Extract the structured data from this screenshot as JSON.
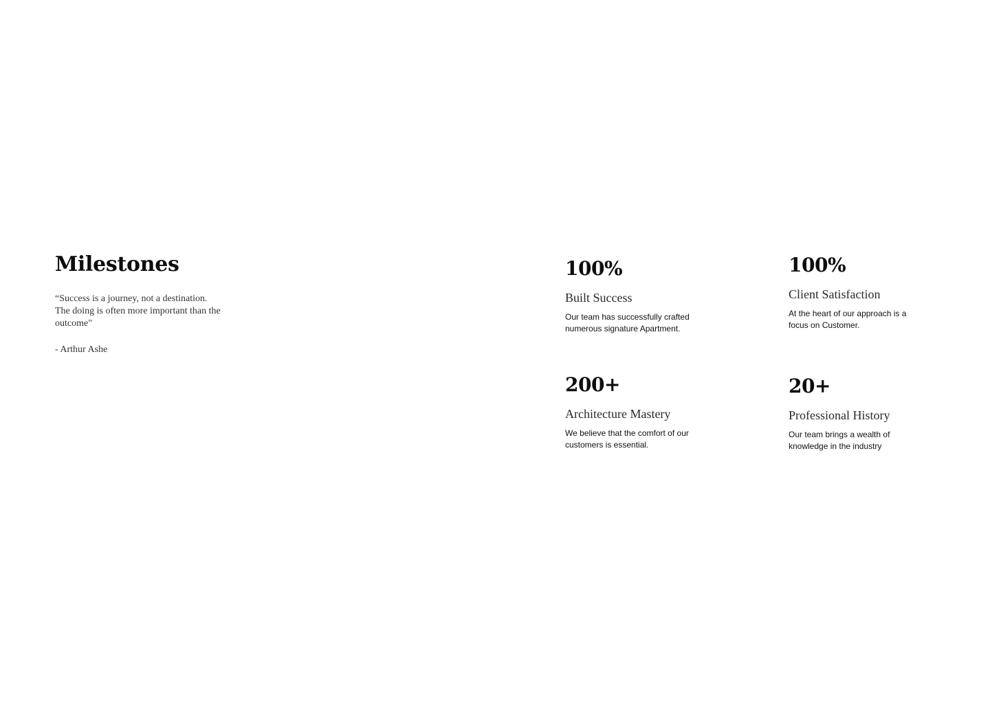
{
  "milestones": {
    "heading": "Milestones",
    "quote": "“Success is a journey, not a destination.\nThe doing is often more important than the outcome\"",
    "author": "- Arthur Ashe"
  },
  "stats": [
    {
      "value": "100%",
      "title": "Built Success",
      "description": "Our team has successfully crafted numerous signature Apartment."
    },
    {
      "value": "100%",
      "title": "Client Satisfaction",
      "description": "At the heart of our approach is a focus on Customer."
    },
    {
      "value": "200+",
      "title": "Architecture Mastery",
      "description": "We believe that the comfort of our customers is essential."
    },
    {
      "value": "20+",
      "title": "Professional History",
      "description": "Our team brings a wealth of knowledge in the industry"
    }
  ]
}
